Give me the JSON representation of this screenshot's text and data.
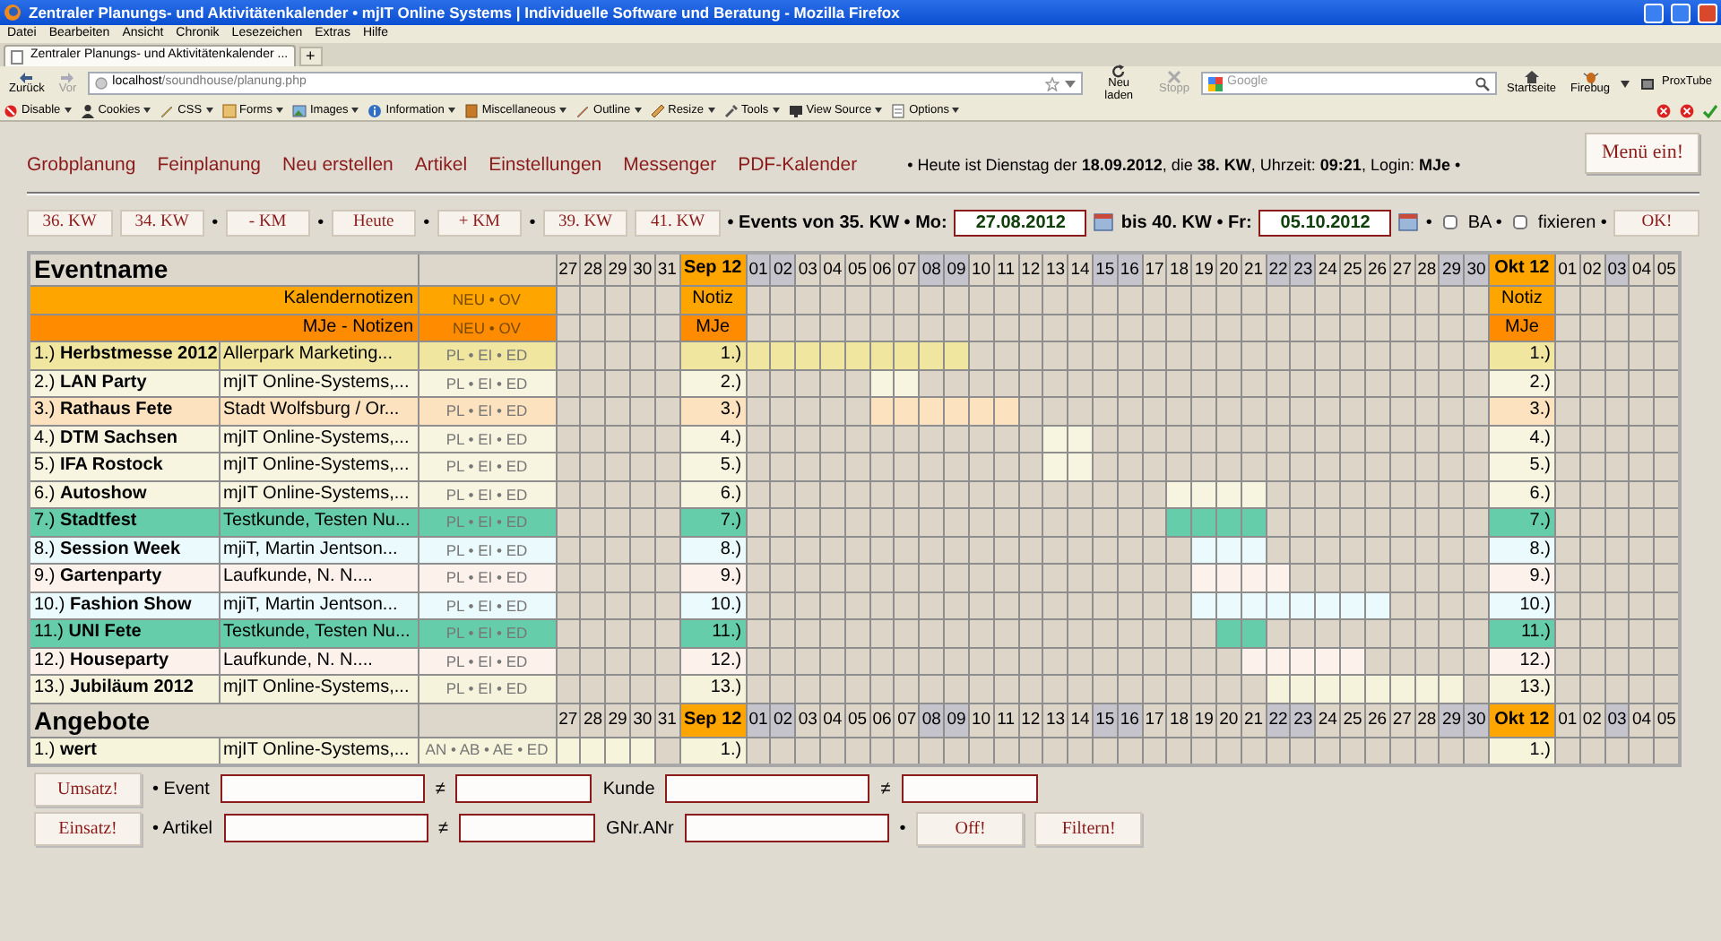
{
  "browser": {
    "title": "Zentraler Planungs- und Aktivitätenkalender • mjIT Online Systems | Individuelle Software und Beratung - Mozilla Firefox",
    "menu": [
      "Datei",
      "Bearbeiten",
      "Ansicht",
      "Chronik",
      "Lesezeichen",
      "Extras",
      "Hilfe"
    ],
    "tabs": [
      {
        "label": "Zentraler Planungs- und Aktivitätenkalender ...",
        "selected": true
      }
    ],
    "new_tab": "+",
    "nav_left": [
      {
        "label": "Zurück",
        "disabled": false
      },
      {
        "label": "Vor",
        "disabled": true
      }
    ],
    "url": {
      "host": "localhost",
      "path": "/soundhouse/planung.php"
    },
    "nav_mid": [
      {
        "label": "Neu laden",
        "disabled": false
      },
      {
        "label": "Stopp",
        "disabled": true
      }
    ],
    "search": {
      "placeholder": "Google"
    },
    "nav_right": [
      {
        "label": "Startseite"
      },
      {
        "label": "Firebug"
      }
    ],
    "addon": "ProxTube",
    "devtools": [
      "Disable",
      "Cookies",
      "CSS",
      "Forms",
      "Images",
      "Information",
      "Miscellaneous",
      "Outline",
      "Resize",
      "Tools",
      "View Source",
      "Options"
    ]
  },
  "nav_links": [
    "Grobplanung",
    "Feinplanung",
    "Neu erstellen",
    "Artikel",
    "Einstellungen",
    "Messenger",
    "PDF-Kalender"
  ],
  "status_text": "• Heute ist Dienstag der **18.09.2012**, die **38. KW**, Uhrzeit: **09:21**, Login: **MJe** •",
  "menu_button": "Menü ein!",
  "toolbar": [
    {
      "kind": "button",
      "label": "36. KW"
    },
    {
      "kind": "button",
      "label": "34. KW"
    },
    {
      "kind": "text",
      "label": "•",
      "bold": false
    },
    {
      "kind": "button",
      "label": "- KM"
    },
    {
      "kind": "text",
      "label": "•",
      "bold": false
    },
    {
      "kind": "button",
      "label": "Heute"
    },
    {
      "kind": "text",
      "label": "•",
      "bold": false
    },
    {
      "kind": "button",
      "label": "+ KM"
    },
    {
      "kind": "text",
      "label": "•",
      "bold": false
    },
    {
      "kind": "button",
      "label": "39. KW"
    },
    {
      "kind": "button",
      "label": "41. KW"
    },
    {
      "kind": "text",
      "label": "• Events von 35. KW • Mo:",
      "bold": true
    },
    {
      "kind": "date",
      "value": "27.08.2012"
    },
    {
      "kind": "text",
      "label": "bis 40. KW • Fr:",
      "bold": true
    },
    {
      "kind": "date",
      "value": "05.10.2012"
    },
    {
      "kind": "text",
      "label": "•",
      "bold": false
    },
    {
      "kind": "checkbox",
      "checked": false
    },
    {
      "kind": "text",
      "label": "BA •",
      "bold": false
    },
    {
      "kind": "checkbox",
      "checked": false
    },
    {
      "kind": "text",
      "label": "fixieren •",
      "bold": false
    },
    {
      "kind": "button",
      "label": "OK!"
    }
  ],
  "events": {
    "header": "Eventname",
    "columns": [
      {
        "kind": "day",
        "label": "27",
        "weekend": false
      },
      {
        "kind": "day",
        "label": "28",
        "weekend": false
      },
      {
        "kind": "day",
        "label": "29",
        "weekend": false
      },
      {
        "kind": "day",
        "label": "30",
        "weekend": false
      },
      {
        "kind": "day",
        "label": "31",
        "weekend": false
      },
      {
        "kind": "month",
        "label": "Sep 12"
      },
      {
        "kind": "day",
        "label": "01",
        "weekend": true
      },
      {
        "kind": "day",
        "label": "02",
        "weekend": true
      },
      {
        "kind": "day",
        "label": "03",
        "weekend": false
      },
      {
        "kind": "day",
        "label": "04",
        "weekend": false
      },
      {
        "kind": "day",
        "label": "05",
        "weekend": false
      },
      {
        "kind": "day",
        "label": "06",
        "weekend": false
      },
      {
        "kind": "day",
        "label": "07",
        "weekend": false
      },
      {
        "kind": "day",
        "label": "08",
        "weekend": true
      },
      {
        "kind": "day",
        "label": "09",
        "weekend": true
      },
      {
        "kind": "day",
        "label": "10",
        "weekend": false
      },
      {
        "kind": "day",
        "label": "11",
        "weekend": false
      },
      {
        "kind": "day",
        "label": "12",
        "weekend": false
      },
      {
        "kind": "day",
        "label": "13",
        "weekend": false
      },
      {
        "kind": "day",
        "label": "14",
        "weekend": false
      },
      {
        "kind": "day",
        "label": "15",
        "weekend": true
      },
      {
        "kind": "day",
        "label": "16",
        "weekend": true
      },
      {
        "kind": "day",
        "label": "17",
        "weekend": false
      },
      {
        "kind": "day",
        "label": "18",
        "weekend": false
      },
      {
        "kind": "day",
        "label": "19",
        "weekend": false
      },
      {
        "kind": "day",
        "label": "20",
        "weekend": false
      },
      {
        "kind": "day",
        "label": "21",
        "weekend": false
      },
      {
        "kind": "day",
        "label": "22",
        "weekend": true
      },
      {
        "kind": "day",
        "label": "23",
        "weekend": true
      },
      {
        "kind": "day",
        "label": "24",
        "weekend": false
      },
      {
        "kind": "day",
        "label": "25",
        "weekend": false
      },
      {
        "kind": "day",
        "label": "26",
        "weekend": false
      },
      {
        "kind": "day",
        "label": "27",
        "weekend": false
      },
      {
        "kind": "day",
        "label": "28",
        "weekend": false
      },
      {
        "kind": "day",
        "label": "29",
        "weekend": true
      },
      {
        "kind": "day",
        "label": "30",
        "weekend": true
      },
      {
        "kind": "month",
        "label": "Okt 12"
      },
      {
        "kind": "day",
        "label": "01",
        "weekend": false
      },
      {
        "kind": "day",
        "label": "02",
        "weekend": false
      },
      {
        "kind": "day",
        "label": "03",
        "weekend": true
      },
      {
        "kind": "day",
        "label": "04",
        "weekend": false
      },
      {
        "kind": "day",
        "label": "05",
        "weekend": false
      }
    ],
    "note_rows": [
      {
        "label": "Kalendernotizen",
        "actions": "NEU • OV",
        "month_cells": [
          "Notiz",
          "Notiz"
        ],
        "color": "#ffa500"
      },
      {
        "label": "MJe - Notizen",
        "actions": "NEU • OV",
        "month_cells": [
          "MJe",
          "MJe"
        ],
        "color": "#ff8c00"
      }
    ],
    "rows": [
      {
        "label": "1.) **Herbstmesse 2012**",
        "customer": "Allerpark Marketing...",
        "actions": "PL • EI • ED",
        "month_cells": [
          "1.)",
          "1.)"
        ],
        "color": "#f0e6a0",
        "cells": [
          false,
          false,
          false,
          false,
          false,
          true,
          true,
          true,
          true,
          true,
          true,
          true,
          true,
          true,
          false,
          false,
          false,
          false,
          false,
          false,
          false,
          false,
          false,
          false,
          false,
          false,
          false,
          false,
          false,
          false,
          false,
          false,
          false,
          false,
          false,
          false,
          false,
          false,
          false,
          false
        ]
      },
      {
        "label": "2.) **LAN Party**",
        "customer": "mjIT Online-Systems,...",
        "actions": "PL • EI • ED",
        "month_cells": [
          "2.)",
          "2.)"
        ],
        "color": "#f7f5e0",
        "cells": [
          false,
          false,
          false,
          false,
          false,
          false,
          false,
          false,
          false,
          false,
          true,
          true,
          false,
          false,
          false,
          false,
          false,
          false,
          false,
          false,
          false,
          false,
          false,
          false,
          false,
          false,
          false,
          false,
          false,
          false,
          false,
          false,
          false,
          false,
          false,
          false,
          false,
          false,
          false,
          false
        ]
      },
      {
        "label": "3.) **Rathaus Fete**",
        "customer": "Stadt Wolfsburg / Or...",
        "actions": "PL • EI • ED",
        "month_cells": [
          "3.)",
          "3.)"
        ],
        "color": "#fde2bf",
        "cells": [
          false,
          false,
          false,
          false,
          false,
          false,
          false,
          false,
          false,
          false,
          true,
          true,
          true,
          true,
          true,
          true,
          false,
          false,
          false,
          false,
          false,
          false,
          false,
          false,
          false,
          false,
          false,
          false,
          false,
          false,
          false,
          false,
          false,
          false,
          false,
          false,
          false,
          false,
          false,
          false
        ]
      },
      {
        "label": "4.) **DTM Sachsen**",
        "customer": "mjIT Online-Systems,...",
        "actions": "PL • EI • ED",
        "month_cells": [
          "4.)",
          "4.)"
        ],
        "color": "#f7f5e0",
        "cells": [
          false,
          false,
          false,
          false,
          false,
          false,
          false,
          false,
          false,
          false,
          false,
          false,
          false,
          false,
          false,
          false,
          false,
          true,
          true,
          false,
          false,
          false,
          false,
          false,
          false,
          false,
          false,
          false,
          false,
          false,
          false,
          false,
          false,
          false,
          false,
          false,
          false,
          false,
          false,
          false
        ]
      },
      {
        "label": "5.) **IFA Rostock**",
        "customer": "mjIT Online-Systems,...",
        "actions": "PL • EI • ED",
        "month_cells": [
          "5.)",
          "5.)"
        ],
        "color": "#f7f5e0",
        "cells": [
          false,
          false,
          false,
          false,
          false,
          false,
          false,
          false,
          false,
          false,
          false,
          false,
          false,
          false,
          false,
          false,
          false,
          true,
          true,
          false,
          false,
          false,
          false,
          false,
          false,
          false,
          false,
          false,
          false,
          false,
          false,
          false,
          false,
          false,
          false,
          false,
          false,
          false,
          false,
          false
        ]
      },
      {
        "label": "6.) **Autoshow**",
        "customer": "mjIT Online-Systems,...",
        "actions": "PL • EI • ED",
        "month_cells": [
          "6.)",
          "6.)"
        ],
        "color": "#f7f5e0",
        "cells": [
          false,
          false,
          false,
          false,
          false,
          false,
          false,
          false,
          false,
          false,
          false,
          false,
          false,
          false,
          false,
          false,
          false,
          false,
          false,
          false,
          false,
          false,
          true,
          true,
          true,
          true,
          false,
          false,
          false,
          false,
          false,
          false,
          false,
          false,
          false,
          false,
          false,
          false,
          false,
          false
        ]
      },
      {
        "label": "7.) **Stadtfest**",
        "customer": "Testkunde, Testen Nu...",
        "actions": "PL • EI • ED",
        "month_cells": [
          "7.)",
          "7.)"
        ],
        "color": "#66cdaa",
        "cells": [
          false,
          false,
          false,
          false,
          false,
          false,
          false,
          false,
          false,
          false,
          false,
          false,
          false,
          false,
          false,
          false,
          false,
          false,
          false,
          false,
          false,
          false,
          true,
          true,
          true,
          true,
          false,
          false,
          false,
          false,
          false,
          false,
          false,
          false,
          false,
          false,
          false,
          false,
          false,
          false
        ]
      },
      {
        "label": "8.) **Session Week**",
        "customer": "mjiT, Martin Jentson...",
        "actions": "PL • EI • ED",
        "month_cells": [
          "8.)",
          "8.)"
        ],
        "color": "#ebfafc",
        "cells": [
          false,
          false,
          false,
          false,
          false,
          false,
          false,
          false,
          false,
          false,
          false,
          false,
          false,
          false,
          false,
          false,
          false,
          false,
          false,
          false,
          false,
          false,
          false,
          true,
          true,
          true,
          false,
          false,
          false,
          false,
          false,
          false,
          false,
          false,
          false,
          false,
          false,
          false,
          false,
          false
        ]
      },
      {
        "label": "9.) **Gartenparty**",
        "customer": "Laufkunde, N. N....",
        "actions": "PL • EI • ED",
        "month_cells": [
          "9.)",
          "9.)"
        ],
        "color": "#fdf1ec",
        "cells": [
          false,
          false,
          false,
          false,
          false,
          false,
          false,
          false,
          false,
          false,
          false,
          false,
          false,
          false,
          false,
          false,
          false,
          false,
          false,
          false,
          false,
          false,
          false,
          true,
          true,
          true,
          true,
          false,
          false,
          false,
          false,
          false,
          false,
          false,
          false,
          false,
          false,
          false,
          false,
          false
        ]
      },
      {
        "label": "10.) **Fashion Show**",
        "customer": "mjiT, Martin Jentson...",
        "actions": "PL • EI • ED",
        "month_cells": [
          "10.)",
          "10.)"
        ],
        "color": "#ebfafc",
        "cells": [
          false,
          false,
          false,
          false,
          false,
          false,
          false,
          false,
          false,
          false,
          false,
          false,
          false,
          false,
          false,
          false,
          false,
          false,
          false,
          false,
          false,
          false,
          false,
          true,
          true,
          true,
          true,
          true,
          true,
          true,
          true,
          false,
          false,
          false,
          false,
          false,
          false,
          false,
          false,
          false
        ]
      },
      {
        "label": "11.) **UNI Fete**",
        "customer": "Testkunde, Testen Nu...",
        "actions": "PL • EI • ED",
        "month_cells": [
          "11.)",
          "11.)"
        ],
        "color": "#66cdaa",
        "cells": [
          false,
          false,
          false,
          false,
          false,
          false,
          false,
          false,
          false,
          false,
          false,
          false,
          false,
          false,
          false,
          false,
          false,
          false,
          false,
          false,
          false,
          false,
          false,
          false,
          true,
          true,
          false,
          false,
          false,
          false,
          false,
          false,
          false,
          false,
          false,
          false,
          false,
          false,
          false,
          false
        ]
      },
      {
        "label": "12.) **Houseparty**",
        "customer": "Laufkunde, N. N....",
        "actions": "PL • EI • ED",
        "month_cells": [
          "12.)",
          "12.)"
        ],
        "color": "#fdf1ec",
        "cells": [
          false,
          false,
          false,
          false,
          false,
          false,
          false,
          false,
          false,
          false,
          false,
          false,
          false,
          false,
          false,
          false,
          false,
          false,
          false,
          false,
          false,
          false,
          false,
          false,
          false,
          true,
          true,
          true,
          true,
          true,
          false,
          false,
          false,
          false,
          false,
          false,
          false,
          false,
          false,
          false
        ]
      },
      {
        "label": "13.) **Jubiläum 2012**",
        "customer": "mjIT Online-Systems,...",
        "actions": "PL • EI • ED",
        "month_cells": [
          "13.)",
          "13.)"
        ],
        "color": "#f5f3dc",
        "cells": [
          false,
          false,
          false,
          false,
          false,
          false,
          false,
          false,
          false,
          false,
          false,
          false,
          false,
          false,
          false,
          false,
          false,
          false,
          false,
          false,
          false,
          false,
          false,
          false,
          false,
          false,
          true,
          true,
          true,
          true,
          true,
          true,
          true,
          true,
          false,
          false,
          false,
          false,
          false,
          false
        ]
      }
    ]
  },
  "offers": {
    "header": "Angebote",
    "columns": [
      {
        "kind": "day",
        "label": "27",
        "weekend": false
      },
      {
        "kind": "day",
        "label": "28",
        "weekend": false
      },
      {
        "kind": "day",
        "label": "29",
        "weekend": false
      },
      {
        "kind": "day",
        "label": "30",
        "weekend": false
      },
      {
        "kind": "day",
        "label": "31",
        "weekend": false
      },
      {
        "kind": "month",
        "label": "Sep 12"
      },
      {
        "kind": "day",
        "label": "01",
        "weekend": true
      },
      {
        "kind": "day",
        "label": "02",
        "weekend": true
      },
      {
        "kind": "day",
        "label": "03",
        "weekend": false
      },
      {
        "kind": "day",
        "label": "04",
        "weekend": false
      },
      {
        "kind": "day",
        "label": "05",
        "weekend": false
      },
      {
        "kind": "day",
        "label": "06",
        "weekend": false
      },
      {
        "kind": "day",
        "label": "07",
        "weekend": false
      },
      {
        "kind": "day",
        "label": "08",
        "weekend": true
      },
      {
        "kind": "day",
        "label": "09",
        "weekend": true
      },
      {
        "kind": "day",
        "label": "10",
        "weekend": false
      },
      {
        "kind": "day",
        "label": "11",
        "weekend": false
      },
      {
        "kind": "day",
        "label": "12",
        "weekend": false
      },
      {
        "kind": "day",
        "label": "13",
        "weekend": false
      },
      {
        "kind": "day",
        "label": "14",
        "weekend": false
      },
      {
        "kind": "day",
        "label": "15",
        "weekend": true
      },
      {
        "kind": "day",
        "label": "16",
        "weekend": true
      },
      {
        "kind": "day",
        "label": "17",
        "weekend": false
      },
      {
        "kind": "day",
        "label": "18",
        "weekend": false
      },
      {
        "kind": "day",
        "label": "19",
        "weekend": false
      },
      {
        "kind": "day",
        "label": "20",
        "weekend": false
      },
      {
        "kind": "day",
        "label": "21",
        "weekend": false
      },
      {
        "kind": "day",
        "label": "22",
        "weekend": true
      },
      {
        "kind": "day",
        "label": "23",
        "weekend": true
      },
      {
        "kind": "day",
        "label": "24",
        "weekend": false
      },
      {
        "kind": "day",
        "label": "25",
        "weekend": false
      },
      {
        "kind": "day",
        "label": "26",
        "weekend": false
      },
      {
        "kind": "day",
        "label": "27",
        "weekend": false
      },
      {
        "kind": "day",
        "label": "28",
        "weekend": false
      },
      {
        "kind": "day",
        "label": "29",
        "weekend": true
      },
      {
        "kind": "day",
        "label": "30",
        "weekend": true
      },
      {
        "kind": "month",
        "label": "Okt 12"
      },
      {
        "kind": "day",
        "label": "01",
        "weekend": false
      },
      {
        "kind": "day",
        "label": "02",
        "weekend": false
      },
      {
        "kind": "day",
        "label": "03",
        "weekend": true
      },
      {
        "kind": "day",
        "label": "04",
        "weekend": false
      },
      {
        "kind": "day",
        "label": "05",
        "weekend": false
      }
    ],
    "rows": [
      {
        "label": "1.) **wert**",
        "customer": "mjIT Online-Systems,...",
        "actions": "AN • AB • AE • ED",
        "month_cells": [
          "1.)",
          "1.)"
        ],
        "color": "#f7f4dc",
        "cells": [
          true,
          true,
          true,
          true,
          false,
          false,
          false,
          false,
          false,
          false,
          false,
          false,
          false,
          false,
          false,
          false,
          false,
          false,
          false,
          false,
          false,
          false,
          false,
          false,
          false,
          false,
          false,
          false,
          false,
          false,
          false,
          false,
          false,
          false,
          false,
          false,
          false,
          false,
          false,
          false
        ]
      }
    ]
  },
  "filters": [
    [
      {
        "kind": "button",
        "label": "Umsatz!"
      },
      {
        "kind": "text",
        "label": "• Event"
      },
      {
        "kind": "input"
      },
      {
        "kind": "not_equal",
        "label": "≠"
      },
      {
        "kind": "input"
      },
      {
        "kind": "text",
        "label": "Kunde"
      },
      {
        "kind": "input"
      },
      {
        "kind": "not_equal",
        "label": "≠"
      },
      {
        "kind": "input"
      }
    ],
    [
      {
        "kind": "button",
        "label": "Einsatz!"
      },
      {
        "kind": "text",
        "label": "• Artikel"
      },
      {
        "kind": "input"
      },
      {
        "kind": "not_equal",
        "label": "≠"
      },
      {
        "kind": "input"
      },
      {
        "kind": "text",
        "label": "GNr.ANr"
      },
      {
        "kind": "input"
      },
      {
        "kind": "text",
        "label": "•"
      },
      {
        "kind": "button",
        "label": "Off!"
      },
      {
        "kind": "button",
        "label": "Filtern!"
      }
    ]
  ]
}
